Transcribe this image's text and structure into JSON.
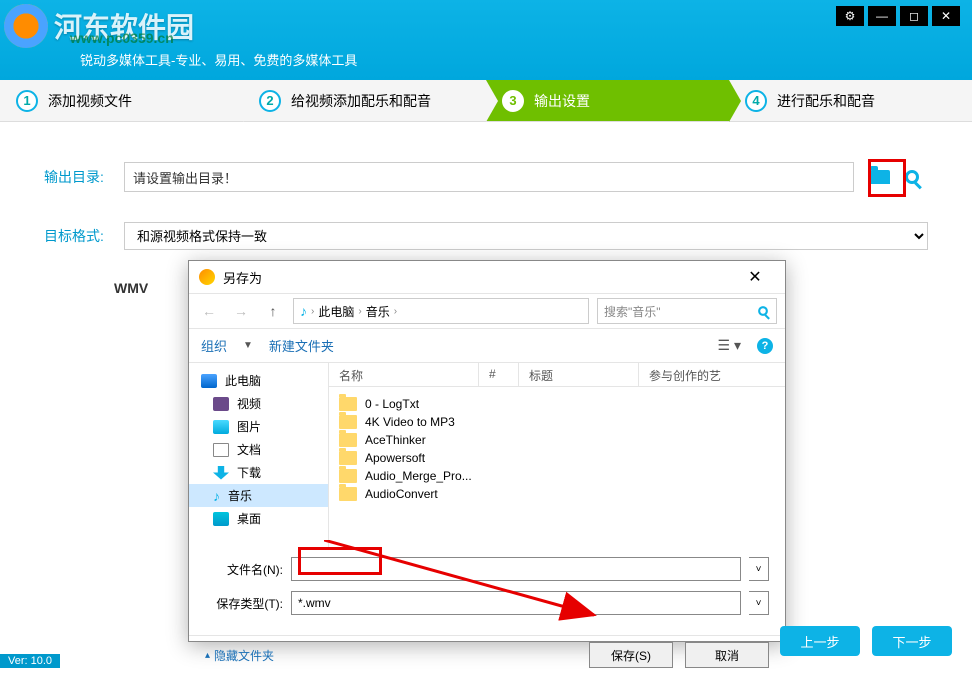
{
  "header": {
    "watermark_text": "河东软件园",
    "watermark_url": "www.pc0359.cn",
    "subtitle": "锐动多媒体工具-专业、易用、免费的多媒体工具"
  },
  "steps": [
    {
      "num": "1",
      "label": "添加视频文件"
    },
    {
      "num": "2",
      "label": "给视频添加配乐和配音"
    },
    {
      "num": "3",
      "label": "输出设置"
    },
    {
      "num": "4",
      "label": "进行配乐和配音"
    }
  ],
  "settings": {
    "output_dir_label": "输出目录:",
    "output_dir_value": "请设置输出目录！",
    "target_format_label": "目标格式:",
    "target_format_value": "和源视频格式保持一致",
    "format_badge": "WMV"
  },
  "dialog": {
    "title": "另存为",
    "crumb_pc": "此电脑",
    "crumb_music": "音乐",
    "search_placeholder": "搜索\"音乐\"",
    "organize": "组织",
    "new_folder": "新建文件夹",
    "tree": [
      {
        "label": "此电脑",
        "icon": "pc",
        "root": true
      },
      {
        "label": "视频",
        "icon": "vid"
      },
      {
        "label": "图片",
        "icon": "pic"
      },
      {
        "label": "文档",
        "icon": "doc"
      },
      {
        "label": "下载",
        "icon": "dl"
      },
      {
        "label": "音乐",
        "icon": "music",
        "selected": true
      },
      {
        "label": "桌面",
        "icon": "desk"
      }
    ],
    "columns": {
      "name": "名称",
      "num": "#",
      "title": "标题",
      "artist": "参与创作的艺"
    },
    "files": [
      "0 - LogTxt",
      "4K Video to MP3",
      "AceThinker",
      "Apowersoft",
      "Audio_Merge_Pro...",
      "AudioConvert"
    ],
    "filename_label": "文件名(N):",
    "filename_value": "",
    "filetype_label": "保存类型(T):",
    "filetype_value": "*.wmv",
    "hide_folders": "隐藏文件夹",
    "save_btn": "保存(S)",
    "cancel_btn": "取消"
  },
  "nav": {
    "prev": "上一步",
    "next": "下一步"
  },
  "version": "Ver: 10.0"
}
